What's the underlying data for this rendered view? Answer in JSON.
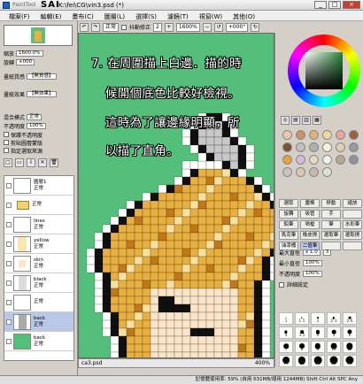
{
  "window": {
    "brand": "PaintTool",
    "app_name": "SAI",
    "file_path": "K:\\fei\\CG\\vin3.psd (*)",
    "min_label": "_",
    "max_label": "□",
    "close_label": "×"
  },
  "menu": [
    "檔案(F)",
    "編輯(E)",
    "畫布(C)",
    "圖層(L)",
    "選擇(S)",
    "濾鏡(T)",
    "視窗(W)",
    "其他(O)"
  ],
  "toolbar": {
    "blend_mode": "正常",
    "antialias_label": "抖動修正",
    "stabilizer_value": "2",
    "zoom_value": "1600%",
    "rotate_value": "+000°"
  },
  "left_panel": {
    "zoom_label": "縮放",
    "zoom_value": "1600.0%",
    "rotate_label": "旋轉",
    "rotate_value": "+000",
    "paper1_label": "畫紙質感",
    "paper1_value": "【無質感】",
    "paper2_label": "畫紙效果",
    "paper2_value": "【無效果】",
    "blend_label": "混合模式",
    "blend_value": "正常",
    "opacity_label": "不透明度",
    "opacity_value": "100%",
    "check_protect": "保護不透明度",
    "check_clip": "剪貼圖層蒙版",
    "check_select": "指定選取來源"
  },
  "layers": [
    {
      "name": "圖層1",
      "mode": "正常",
      "pct": "100%"
    },
    {
      "name": "正常",
      "mode": "",
      "pct": "100%"
    },
    {
      "name": "lines",
      "mode": "正常",
      "pct": "100%"
    },
    {
      "name": "yellow",
      "mode": "正常",
      "pct": "100%"
    },
    {
      "name": "skin",
      "mode": "正常",
      "pct": "100%"
    },
    {
      "name": "black",
      "mode": "正常",
      "pct": "100%"
    },
    {
      "name": "正常",
      "mode": "",
      "pct": "100%"
    },
    {
      "name": "back",
      "mode": "正常",
      "pct": "100%"
    },
    {
      "name": "back",
      "mode": "正常",
      "pct": "100%"
    }
  ],
  "annotation": {
    "line1": "7. 在周圍描上白邊．描的時",
    "line2": "候開個底色比較好檢視。",
    "line3": "這時為了讓邊緣明顯，所",
    "line4": "以描了直角。"
  },
  "colors": {
    "canvas_bg": "#54bf7a",
    "hair": "#e8b040",
    "hair_light": "#f8e0a0",
    "hair_dark": "#c07818",
    "skin": "#fbe4c8",
    "outline": "#101010",
    "white_border": "#ffffff",
    "grey": "#c8c8c8"
  },
  "swatches": [
    "#e8c8a8",
    "#c89070",
    "#e0b080",
    "#f0d8a0",
    "#f0a0a0",
    "#a06040",
    "#805030",
    "#c0c0c0",
    "#b0b0b0",
    "#f8f0d8",
    "#e0d0b0",
    "#989898",
    "#e8a040",
    "#d8b8d8",
    "#e8d8c0",
    "#f0f0f0",
    "#b8a890",
    "#9090a0",
    "#d0c0c0",
    "#d8c8b0",
    "#c8b8a8",
    "#e0e0d0"
  ],
  "tools": [
    "選取",
    "魔棒",
    "移動",
    "縮放",
    "旋轉",
    "吸管",
    "手",
    "",
    "鉛筆",
    "噴槍",
    "筆",
    "水彩筆",
    "馬克筆",
    "橡皮擦",
    "選取筆",
    "選取擦",
    "油漆桶",
    "二值筆",
    "",
    ""
  ],
  "brush": {
    "size_label": "最大直徑",
    "size_mult": "x 1.0",
    "size_value": "3",
    "min_label": "最小直徑",
    "min_value": "100%",
    "opacity_label": "不透明度",
    "opacity_value": "100%",
    "detail_label": "詳細設定",
    "sizes": [
      "1",
      "1.5",
      "2",
      "2.3",
      "2.6",
      "3",
      "3.5",
      "4",
      "5",
      "6",
      "7",
      "8",
      "9",
      "10",
      "12",
      "14",
      "16",
      "20",
      "25",
      "30"
    ]
  },
  "doc_tab": {
    "name": "ca3.psd",
    "zoom": "400%"
  },
  "status": {
    "text": "記憶體使用率: 59% (自用 631MB/總用 1244MB)   Shift Ctrl Alt SPC Any"
  }
}
